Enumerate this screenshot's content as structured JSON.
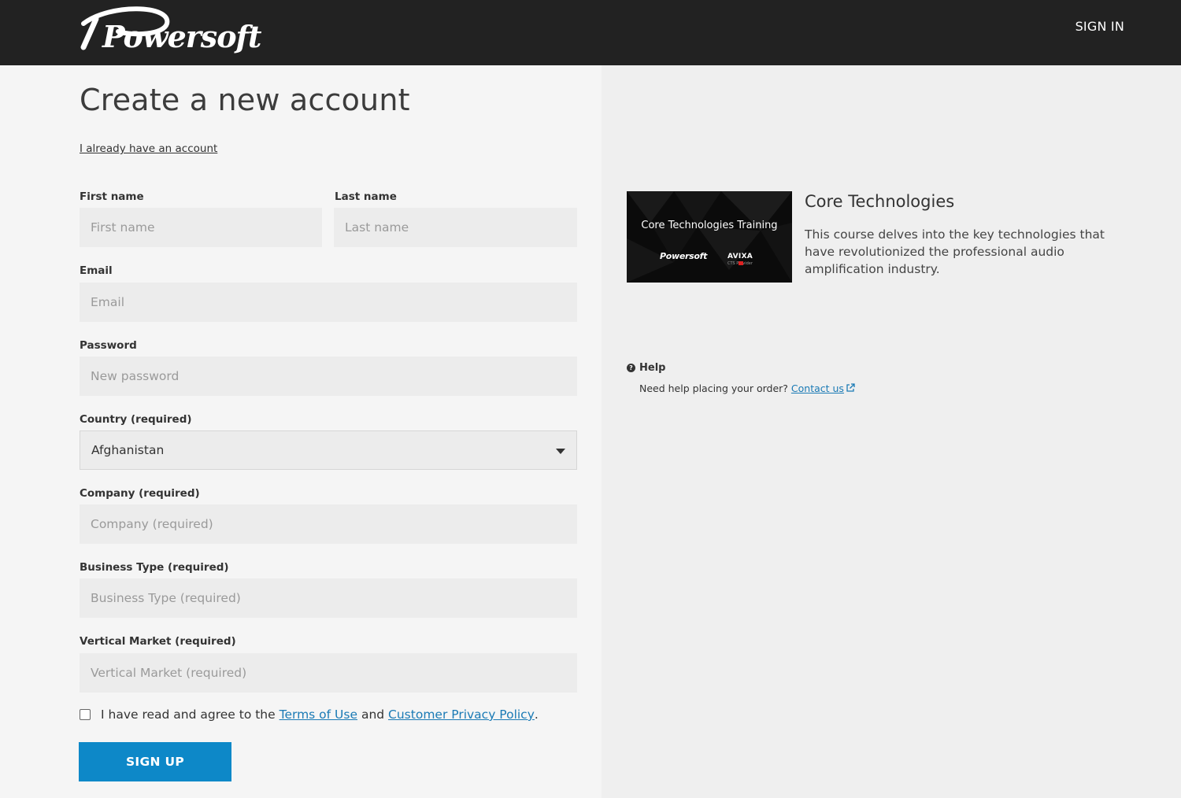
{
  "header": {
    "logo_text": "Powersoft",
    "signin_label": "SIGN IN"
  },
  "form": {
    "title": "Create a new account",
    "already_link": "I already have an account",
    "first_name": {
      "label": "First name",
      "placeholder": "First name",
      "value": ""
    },
    "last_name": {
      "label": "Last name",
      "placeholder": "Last name",
      "value": ""
    },
    "email": {
      "label": "Email",
      "placeholder": "Email",
      "value": ""
    },
    "password": {
      "label": "Password",
      "placeholder": "New password",
      "value": ""
    },
    "country": {
      "label": "Country (required)",
      "selected": "Afghanistan"
    },
    "company": {
      "label": "Company (required)",
      "placeholder": "Company (required)",
      "value": ""
    },
    "business_type": {
      "label": "Business Type (required)",
      "placeholder": "Business Type (required)",
      "value": ""
    },
    "vertical_market": {
      "label": "Vertical Market (required)",
      "placeholder": "Vertical Market (required)",
      "value": ""
    },
    "agree": {
      "checked": false,
      "prefix": "I have read and agree to the ",
      "terms_link": "Terms of Use",
      "middle": " and ",
      "privacy_link": "Customer Privacy Policy",
      "suffix": "."
    },
    "submit_label": "SIGN UP"
  },
  "course": {
    "thumb_title": "Core Technologies Training",
    "thumb_brand_left": "Powersoft",
    "thumb_brand_right": "AVIXA",
    "thumb_brand_right_sub": "CTS    Provider",
    "title": "Core Technologies",
    "description": "This course delves into the key technologies that have revolutionized the professional audio amplification industry."
  },
  "help": {
    "title": "Help",
    "text": "Need help placing your order? ",
    "link": "Contact us"
  },
  "colors": {
    "header_bg": "#222222",
    "accent": "#0d88c8",
    "link": "#1a7ab5"
  }
}
